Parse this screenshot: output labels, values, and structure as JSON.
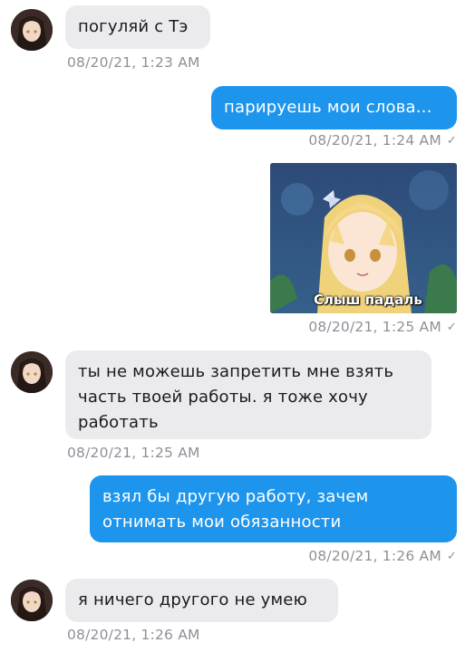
{
  "messages": [
    {
      "text": "погуляй с Тэ",
      "time": "08/20/21, 1:23 AM"
    },
    {
      "text": "парируешь мои слова...",
      "time": "08/20/21, 1:24 AM"
    },
    {
      "image_caption": "Слыш падаль",
      "time": "08/20/21, 1:25 AM"
    },
    {
      "lines": [
        "ты не можешь запретить мне взять",
        "часть твоей работы. я тоже хочу",
        "работать"
      ],
      "time": "08/20/21, 1:25 AM"
    },
    {
      "lines": [
        "взял бы другую работу, зачем",
        "отнимать мои обязанности"
      ],
      "time": "08/20/21, 1:26 AM"
    },
    {
      "text": "я ничего другого не умею",
      "time": "08/20/21, 1:26 AM"
    }
  ],
  "icons": {
    "read_receipt": "check-icon",
    "contact_avatar": "avatar"
  },
  "colors": {
    "outgoing_bubble": "#1e95ec",
    "incoming_bubble": "#ebebee",
    "timestamp": "#8f8f98"
  }
}
